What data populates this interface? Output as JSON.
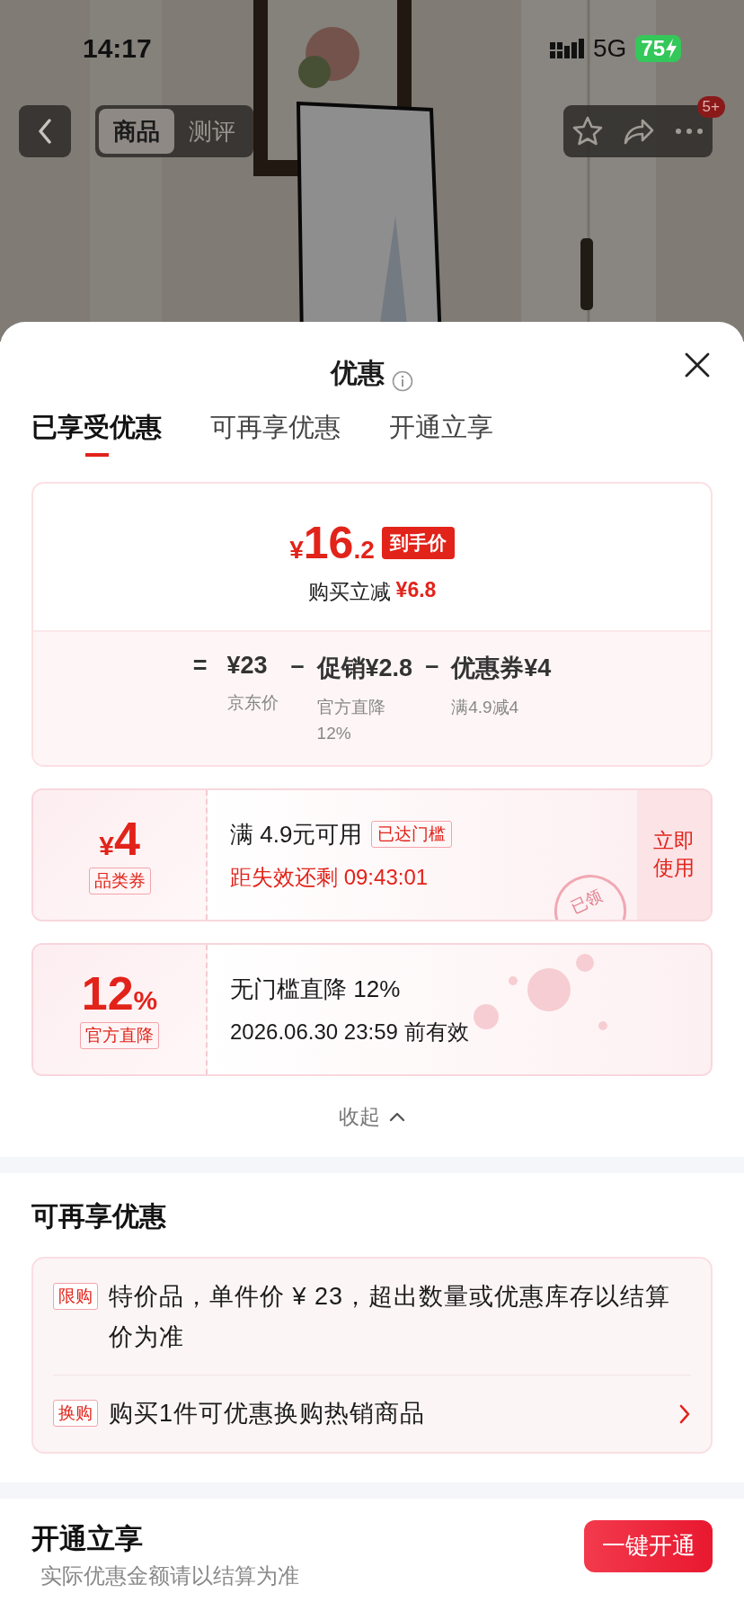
{
  "status_bar": {
    "time": "14:17",
    "network": "5G",
    "battery": "75",
    "charging": true
  },
  "nav": {
    "tabs": [
      {
        "label": "商品",
        "selected": true
      },
      {
        "label": "测评",
        "selected": false
      }
    ],
    "badge": "5+"
  },
  "sheet": {
    "title": "优惠",
    "tabs": [
      {
        "label": "已享受优惠",
        "selected": true
      },
      {
        "label": "可再享优惠",
        "selected": false
      },
      {
        "label": "开通立享",
        "selected": false
      }
    ]
  },
  "price_card": {
    "currency": "¥",
    "integer": "16",
    "decimal": ".2",
    "tag": "到手价",
    "saving_label": "购买立减",
    "saving": "¥6.8",
    "equals": "=",
    "terms": [
      {
        "amount": "¥23",
        "note": "京东价"
      },
      {
        "operator": "–",
        "amount": "促销¥2.8",
        "note": "官方直降12%"
      },
      {
        "operator": "–",
        "amount": "优惠券¥4",
        "note": "满4.9减4"
      }
    ]
  },
  "coupons": [
    {
      "kind": "amount",
      "currency": "¥",
      "value": "4",
      "type": "品类券",
      "title": "满 4.9元可用",
      "tag": "已达门槛",
      "subtitle": "距失效还剩 09:43:01",
      "action": "立即使用",
      "stamp": "已领"
    },
    {
      "kind": "percent",
      "value": "12",
      "unit": "%",
      "type": "官方直降",
      "title": "无门槛直降 12%",
      "subtitle": "2026.06.30 23:59 前有效"
    }
  ],
  "collapse": "收起",
  "more_offers": {
    "heading": "可再享优惠",
    "items": [
      {
        "tag": "限购",
        "text": "特价品，单件价 ¥ 23，超出数量或优惠库存以结算价为准"
      },
      {
        "tag": "换购",
        "text": "购买1件可优惠换购热销商品",
        "link": true
      }
    ]
  },
  "membership": {
    "heading": "开通立享",
    "note": "实际优惠金额请以结算为准",
    "button": "一键开通"
  }
}
